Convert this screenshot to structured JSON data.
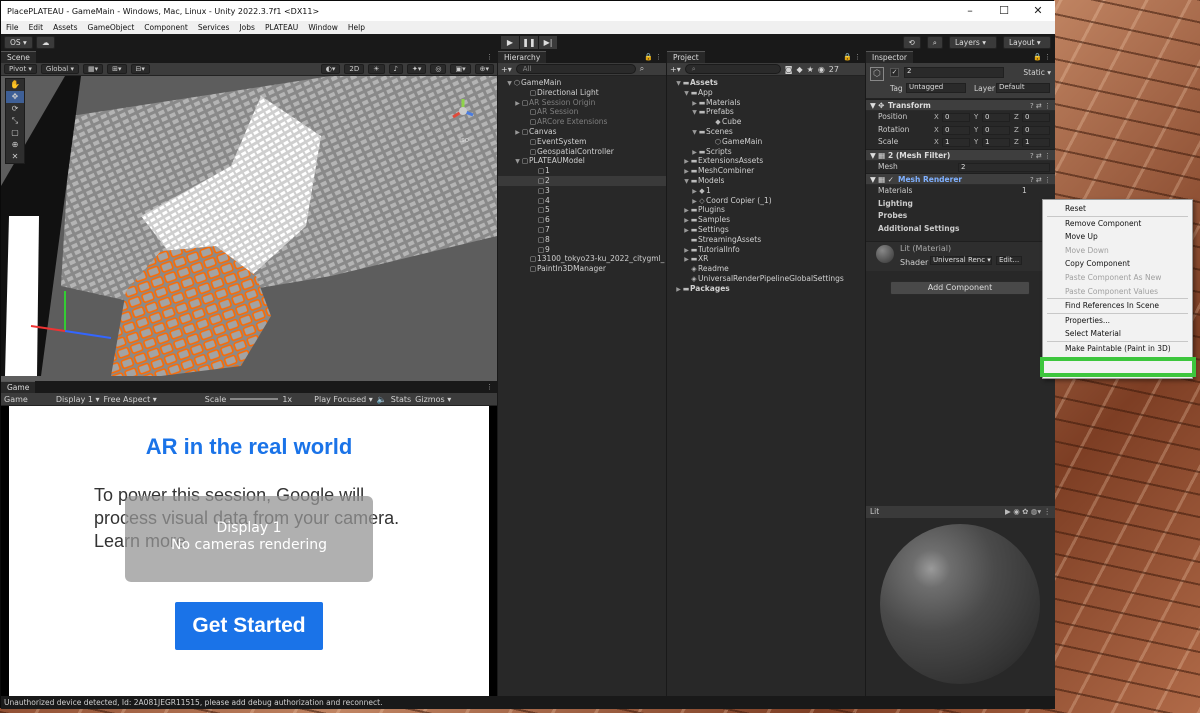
{
  "window": {
    "title": "PlacePLATEAU - GameMain - Windows, Mac, Linux - Unity 2022.3.7f1 <DX11>",
    "min": "–",
    "max": "☐",
    "close": "✕"
  },
  "menu": [
    "File",
    "Edit",
    "Assets",
    "GameObject",
    "Component",
    "Services",
    "Jobs",
    "PLATEAU",
    "Window",
    "Help"
  ],
  "toolbar": {
    "account": "OS ▾",
    "cloud": "☁",
    "layers": "Layers ▾",
    "layout": "Layout ▾",
    "history": "⟲",
    "search": "⌕"
  },
  "play": {
    "play": "▶",
    "pause": "❚❚",
    "step": "▶|"
  },
  "scene": {
    "tab": "Scene",
    "pivot": "Pivot ▾",
    "global": "Global ▾",
    "mode2d": "2D",
    "persp": "Iso",
    "tools": [
      "✋",
      "✥",
      "⟳",
      "⤡",
      "▢",
      "⊕",
      "✕"
    ]
  },
  "game": {
    "tab": "Game",
    "mode": "Game",
    "display": "Display 1 ▾",
    "aspect": "Free Aspect ▾",
    "scale_label": "Scale",
    "scale_value": "1x",
    "play_focused": "Play Focused ▾",
    "stats": "Stats",
    "gizmos": "Gizmos ▾",
    "ar_title": "AR in the real world",
    "ar_body": "To power this session, Google will process visual data from your camera. Learn more",
    "display_overlay": "Display 1",
    "no_cameras": "No cameras rendering",
    "get_started": "Get Started"
  },
  "hierarchy": {
    "tab": "Hierarchy",
    "search": "All",
    "rows": [
      {
        "label": "GameMain",
        "indent": 1,
        "arrow": "▼",
        "icon": "⬡",
        "dim": false,
        "sel": false
      },
      {
        "label": "Directional Light",
        "indent": 3,
        "arrow": "",
        "icon": "▢",
        "dim": false,
        "sel": false
      },
      {
        "label": "AR Session Origin",
        "indent": 2,
        "arrow": "▶",
        "icon": "▢",
        "dim": true,
        "sel": false
      },
      {
        "label": "AR Session",
        "indent": 3,
        "arrow": "",
        "icon": "▢",
        "dim": true,
        "sel": false
      },
      {
        "label": "ARCore Extensions",
        "indent": 3,
        "arrow": "",
        "icon": "▢",
        "dim": true,
        "sel": false
      },
      {
        "label": "Canvas",
        "indent": 2,
        "arrow": "▶",
        "icon": "▢",
        "dim": false,
        "sel": false
      },
      {
        "label": "EventSystem",
        "indent": 3,
        "arrow": "",
        "icon": "▢",
        "dim": false,
        "sel": false
      },
      {
        "label": "GeospatialController",
        "indent": 3,
        "arrow": "",
        "icon": "▢",
        "dim": false,
        "sel": false
      },
      {
        "label": "PLATEAUModel",
        "indent": 2,
        "arrow": "▼",
        "icon": "▢",
        "dim": false,
        "sel": false
      },
      {
        "label": "1",
        "indent": 4,
        "arrow": "",
        "icon": "▢",
        "dim": false,
        "sel": false
      },
      {
        "label": "2",
        "indent": 4,
        "arrow": "",
        "icon": "▢",
        "dim": false,
        "sel": true
      },
      {
        "label": "3",
        "indent": 4,
        "arrow": "",
        "icon": "▢",
        "dim": false,
        "sel": false
      },
      {
        "label": "4",
        "indent": 4,
        "arrow": "",
        "icon": "▢",
        "dim": false,
        "sel": false
      },
      {
        "label": "5",
        "indent": 4,
        "arrow": "",
        "icon": "▢",
        "dim": false,
        "sel": false
      },
      {
        "label": "6",
        "indent": 4,
        "arrow": "",
        "icon": "▢",
        "dim": false,
        "sel": false
      },
      {
        "label": "7",
        "indent": 4,
        "arrow": "",
        "icon": "▢",
        "dim": false,
        "sel": false
      },
      {
        "label": "8",
        "indent": 4,
        "arrow": "",
        "icon": "▢",
        "dim": false,
        "sel": false
      },
      {
        "label": "9",
        "indent": 4,
        "arrow": "",
        "icon": "▢",
        "dim": false,
        "sel": false
      },
      {
        "label": "13100_tokyo23-ku_2022_citygml_",
        "indent": 3,
        "arrow": "",
        "icon": "▢",
        "dim": false,
        "sel": false
      },
      {
        "label": "PaintIn3DManager",
        "indent": 3,
        "arrow": "",
        "icon": "▢",
        "dim": false,
        "sel": false
      }
    ]
  },
  "project": {
    "tab": "Project",
    "count": "27",
    "rows": [
      {
        "label": "Assets",
        "indent": 1,
        "arrow": "▼",
        "icon": "▬",
        "bold": true
      },
      {
        "label": "App",
        "indent": 2,
        "arrow": "▼",
        "icon": "▬",
        "bold": false
      },
      {
        "label": "Materials",
        "indent": 3,
        "arrow": "▶",
        "icon": "▬",
        "bold": false
      },
      {
        "label": "Prefabs",
        "indent": 3,
        "arrow": "▼",
        "icon": "▬",
        "bold": false
      },
      {
        "label": "Cube",
        "indent": 5,
        "arrow": "",
        "icon": "◆",
        "bold": false
      },
      {
        "label": "Scenes",
        "indent": 3,
        "arrow": "▼",
        "icon": "▬",
        "bold": false
      },
      {
        "label": "GameMain",
        "indent": 5,
        "arrow": "",
        "icon": "⬡",
        "bold": false
      },
      {
        "label": "Scripts",
        "indent": 3,
        "arrow": "▶",
        "icon": "▬",
        "bold": false
      },
      {
        "label": "ExtensionsAssets",
        "indent": 2,
        "arrow": "▶",
        "icon": "▬",
        "bold": false
      },
      {
        "label": "MeshCombiner",
        "indent": 2,
        "arrow": "▶",
        "icon": "▬",
        "bold": false
      },
      {
        "label": "Models",
        "indent": 2,
        "arrow": "▼",
        "icon": "▬",
        "bold": false
      },
      {
        "label": "1",
        "indent": 3,
        "arrow": "▶",
        "icon": "◆",
        "bold": false
      },
      {
        "label": "Coord Copier (_1)",
        "indent": 3,
        "arrow": "▶",
        "icon": "◇",
        "bold": false
      },
      {
        "label": "Plugins",
        "indent": 2,
        "arrow": "▶",
        "icon": "▬",
        "bold": false
      },
      {
        "label": "Samples",
        "indent": 2,
        "arrow": "▶",
        "icon": "▬",
        "bold": false
      },
      {
        "label": "Settings",
        "indent": 2,
        "arrow": "▶",
        "icon": "▬",
        "bold": false
      },
      {
        "label": "StreamingAssets",
        "indent": 2,
        "arrow": "",
        "icon": "▬",
        "bold": false
      },
      {
        "label": "TutorialInfo",
        "indent": 2,
        "arrow": "▶",
        "icon": "▬",
        "bold": false
      },
      {
        "label": "XR",
        "indent": 2,
        "arrow": "▶",
        "icon": "▬",
        "bold": false
      },
      {
        "label": "Readme",
        "indent": 2,
        "arrow": "",
        "icon": "◈",
        "bold": false
      },
      {
        "label": "UniversalRenderPipelineGlobalSettings",
        "indent": 2,
        "arrow": "",
        "icon": "◈",
        "bold": false
      },
      {
        "label": "Packages",
        "indent": 1,
        "arrow": "▶",
        "icon": "▬",
        "bold": true
      }
    ]
  },
  "inspector": {
    "tab": "Inspector",
    "object_name": "2",
    "static": "Static ▾",
    "tag_label": "Tag",
    "tag_value": "Untagged",
    "layer_label": "Layer",
    "layer_value": "Default",
    "transform": {
      "title": "Transform",
      "rows": [
        {
          "label": "Position",
          "x": "0",
          "y": "0",
          "z": "0"
        },
        {
          "label": "Rotation",
          "x": "0",
          "y": "0",
          "z": "0"
        },
        {
          "label": "Scale",
          "x": "1",
          "y": "1",
          "z": "1"
        }
      ]
    },
    "mesh_filter": {
      "title": "2 (Mesh Filter)",
      "mesh_label": "Mesh",
      "mesh_value": "2"
    },
    "mesh_renderer": {
      "title": "Mesh Renderer",
      "materials": "Materials",
      "materials_count": "1",
      "lighting": "Lighting",
      "probes": "Probes",
      "additional": "Additional Settings"
    },
    "material": {
      "name": "Lit (Material)",
      "shader_label": "Shader",
      "shader_value": "Universal Renc ▾",
      "edit": "Edit..."
    },
    "add_component": "Add Component",
    "preview_label": "Lit"
  },
  "context_menu": {
    "items": [
      {
        "label": "Reset",
        "disabled": false
      },
      {
        "sep": true
      },
      {
        "label": "Remove Component",
        "disabled": false
      },
      {
        "label": "Move Up",
        "disabled": false
      },
      {
        "label": "Move Down",
        "disabled": true
      },
      {
        "label": "Copy Component",
        "disabled": false
      },
      {
        "label": "Paste Component As New",
        "disabled": true
      },
      {
        "label": "Paste Component Values",
        "disabled": true
      },
      {
        "sep": true
      },
      {
        "label": "Find References In Scene",
        "disabled": false
      },
      {
        "sep": true
      },
      {
        "label": "Properties...",
        "disabled": false
      },
      {
        "label": "Select Material",
        "disabled": false
      },
      {
        "sep": true
      },
      {
        "label": "Make Paintable (Paint in 3D)",
        "disabled": false
      }
    ],
    "highlight_color": "#3dc63d"
  },
  "status_bar": "Unauthorized device detected, Id: 2A081JEGR11515, please add debug authorization and reconnect."
}
